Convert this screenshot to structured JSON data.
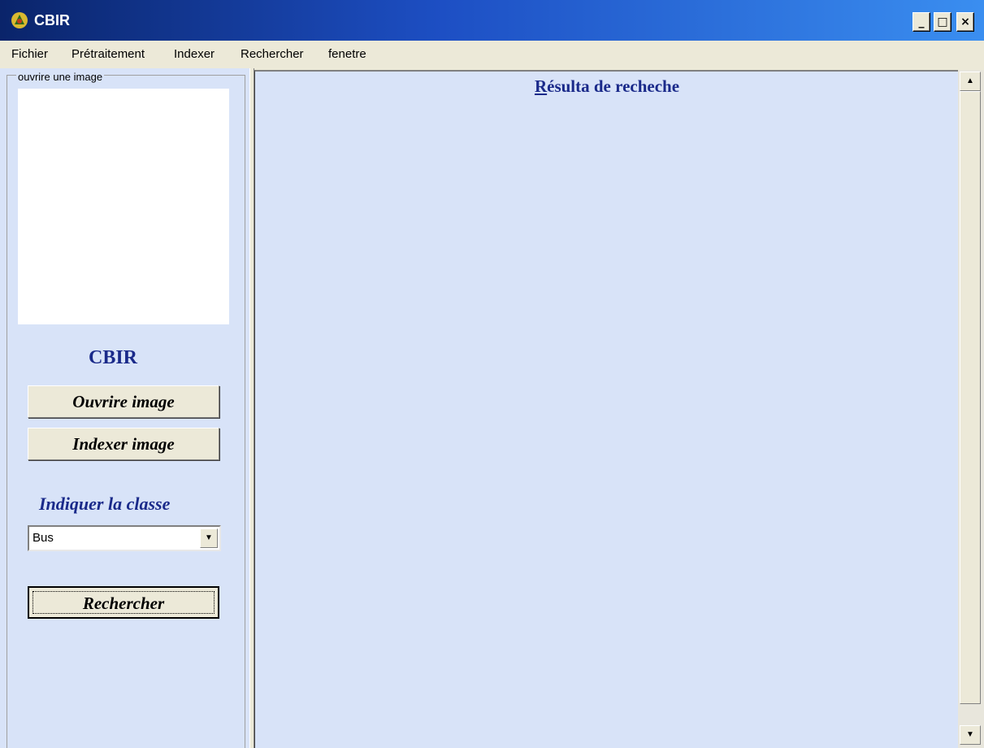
{
  "window": {
    "title": "CBIR",
    "icon": "app-icon",
    "controls": {
      "minimize": "_",
      "maximize": "□",
      "close": "×"
    }
  },
  "menu": {
    "items": [
      "Fichier",
      "Prétraitement",
      "Indexer",
      "Rechercher",
      "fenetre"
    ]
  },
  "left_panel": {
    "group_label": "ouvrire une image",
    "heading": "CBIR",
    "open_button": "Ouvrire image",
    "index_button": "Indexer image",
    "class_label": "Indiquer la classe",
    "class_select": {
      "value": "Bus"
    },
    "search_button": "Rechercher"
  },
  "results": {
    "title": "Résulta de recheche"
  },
  "colors": {
    "panel_bg": "#d8e3f8",
    "accent_text": "#1a2a8a",
    "titlebar_start": "#0a246a",
    "titlebar_end": "#3a8ef0"
  }
}
